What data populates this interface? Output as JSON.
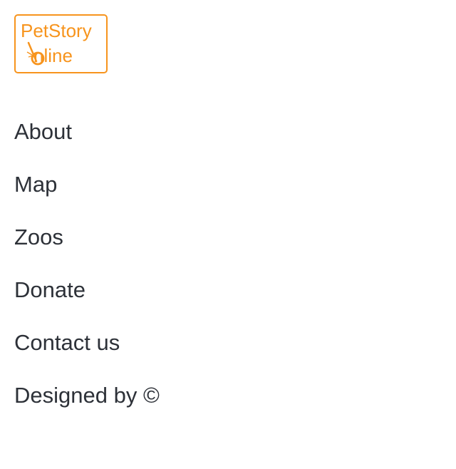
{
  "logo": {
    "line1": "PetStory",
    "line2": "nline",
    "color": "#f7941d"
  },
  "nav": {
    "items": [
      {
        "label": "About"
      },
      {
        "label": "Map"
      },
      {
        "label": "Zoos"
      },
      {
        "label": "Donate"
      },
      {
        "label": "Contact us"
      }
    ]
  },
  "footer": {
    "credit": "Designed by ©"
  },
  "colors": {
    "text": "#2d3138",
    "accent": "#f7941d",
    "background": "#ffffff"
  }
}
